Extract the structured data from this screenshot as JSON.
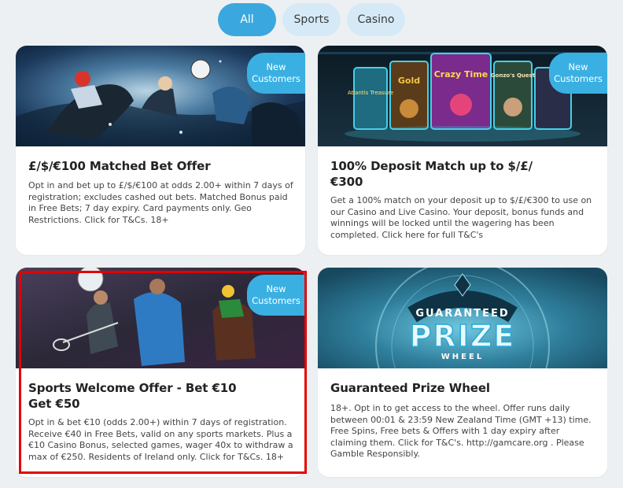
{
  "filter_tabs": [
    {
      "label": "All",
      "active": true
    },
    {
      "label": "Sports",
      "active": false
    },
    {
      "label": "Casino",
      "active": false
    }
  ],
  "colors": {
    "accent": "#3aa8de",
    "badge": "#3ab0e2",
    "tab_inactive_bg": "#d5eaf6",
    "page_bg": "#edf0f2",
    "highlight": "#e40000"
  },
  "promotions": [
    {
      "badge": [
        "New",
        "Customers"
      ],
      "title": "£/$/€100 Matched Bet Offer",
      "description": "Opt in and bet up to £/$/€100 at odds 2.00+ within 7 days of registration; excludes cashed out bets. Matched Bonus paid in Free Bets; 7 day expiry. Card payments only. Geo Restrictions. Click for T&Cs. 18+",
      "image": "horse-racing-football-collage"
    },
    {
      "badge": [
        "New",
        "Customers"
      ],
      "title_lines": [
        "100% Deposit Match up to $/£/",
        "€300"
      ],
      "description": "Get a 100% match on your deposit up to $/£/€300 to use on our Casino and Live Casino. Your deposit, bonus funds and winnings will be locked until the wagering has been completed. Click here for full T&C's",
      "image": "casino-slot-games",
      "image_labels": [
        "Atlantis Treasure",
        "Gold",
        "Crazy Time",
        "Gonzo's Quest"
      ]
    },
    {
      "badge": [
        "New",
        "Customers"
      ],
      "title_lines": [
        "Sports Welcome Offer - Bet €10",
        "Get €50"
      ],
      "description": "Opt in & bet €10 (odds 2.00+) within 7 days of registration. Receive €40 in Free Bets, valid on any sports markets. Plus a €10 Casino Bonus, selected games, wager 40x to withdraw a max of €250. Residents of Ireland only. Click for T&Cs. 18+",
      "image": "sports-athletes-collage",
      "highlighted": true
    },
    {
      "title": "Guaranteed Prize Wheel",
      "description": "18+. Opt in to get access to the wheel. Offer runs daily between 00:01 & 23:59 New Zealand Time (GMT +13) time. Free Spins, Free bets & Offers with 1 day expiry after claiming them. Click for T&C's. http://gamcare.org . Please Gamble Responsibly.",
      "image": "prize-wheel",
      "image_text": [
        "GUARANTEED",
        "PRIZE",
        "WHEEL"
      ]
    }
  ]
}
